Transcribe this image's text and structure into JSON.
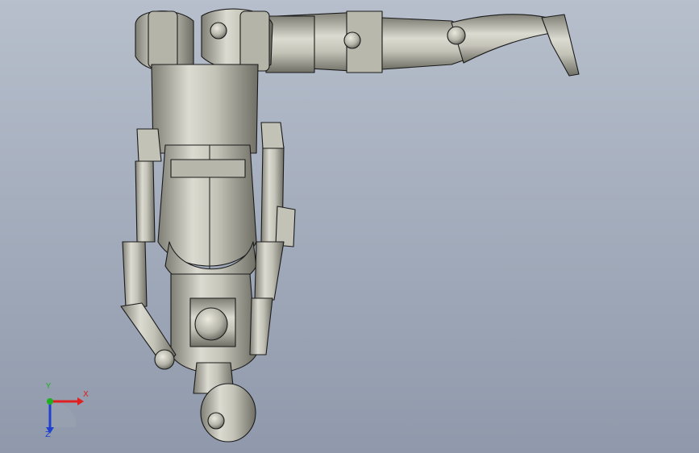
{
  "viewport": {
    "background_top": "#b7bfcc",
    "background_bottom": "#8f99ab"
  },
  "model": {
    "part_fill": "#c9c8bd",
    "part_shade": "#8e8d82",
    "edge_color": "#1a1a1a"
  },
  "triad": {
    "x_label": "X",
    "y_label": "Y",
    "z_label": "Z",
    "x_color": "#e02020",
    "y_color": "#20b020",
    "z_color": "#2040d0"
  }
}
